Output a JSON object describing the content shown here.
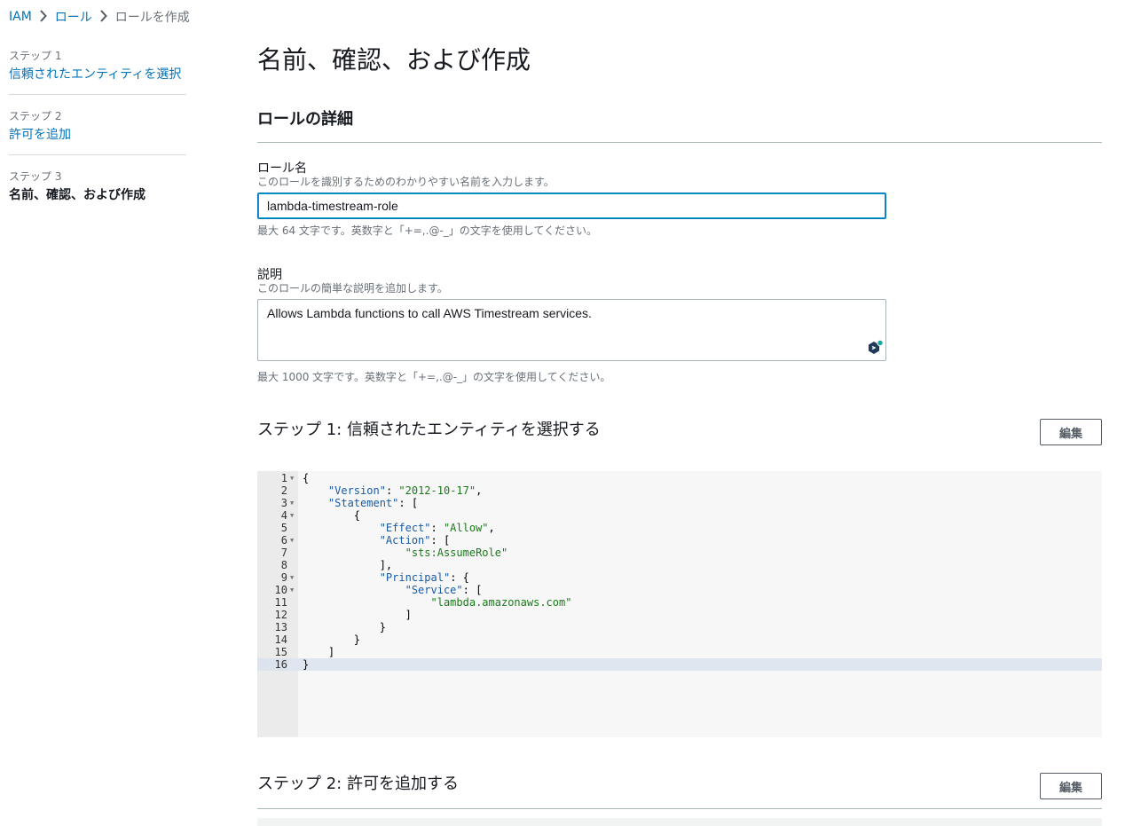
{
  "breadcrumb": {
    "items": [
      "IAM",
      "ロール"
    ],
    "current": "ロールを作成"
  },
  "sidebar": {
    "steps": [
      {
        "number": "ステップ 1",
        "label": "信頼されたエンティティを選択"
      },
      {
        "number": "ステップ 2",
        "label": "許可を追加"
      },
      {
        "number": "ステップ 3",
        "label": "名前、確認、および作成"
      }
    ]
  },
  "main": {
    "title": "名前、確認、および作成",
    "details_title": "ロールの詳細",
    "role_name": {
      "label": "ロール名",
      "description": "このロールを識別するためのわかりやすい名前を入力します。",
      "value": "lambda-timestream-role",
      "hint": "最大 64 文字です。英数字と「+=,.@-_」の文字を使用してください。"
    },
    "description": {
      "label": "説明",
      "description": "このロールの簡単な説明を追加します。",
      "value": "Allows Lambda functions to call AWS Timestream services.",
      "hint": "最大 1000 文字です。英数字と「+=,.@-_」の文字を使用してください。"
    },
    "step1": {
      "title": "ステップ 1: 信頼されたエンティティを選択する",
      "edit_label": "編集"
    },
    "step2": {
      "title": "ステップ 2: 許可を追加する",
      "edit_label": "編集"
    }
  },
  "policy_editor": {
    "lines": [
      {
        "n": "1",
        "fold": true,
        "indent": "",
        "parts": [
          [
            "p",
            "{"
          ]
        ]
      },
      {
        "n": "2",
        "fold": false,
        "indent": "    ",
        "parts": [
          [
            "k",
            "\"Version\""
          ],
          [
            "p",
            ": "
          ],
          [
            "s",
            "\"2012-10-17\""
          ],
          [
            "p",
            ","
          ]
        ]
      },
      {
        "n": "3",
        "fold": true,
        "indent": "    ",
        "parts": [
          [
            "k",
            "\"Statement\""
          ],
          [
            "p",
            ": ["
          ]
        ]
      },
      {
        "n": "4",
        "fold": true,
        "indent": "        ",
        "parts": [
          [
            "p",
            "{"
          ]
        ]
      },
      {
        "n": "5",
        "fold": false,
        "indent": "            ",
        "parts": [
          [
            "k",
            "\"Effect\""
          ],
          [
            "p",
            ": "
          ],
          [
            "s",
            "\"Allow\""
          ],
          [
            "p",
            ","
          ]
        ]
      },
      {
        "n": "6",
        "fold": true,
        "indent": "            ",
        "parts": [
          [
            "k",
            "\"Action\""
          ],
          [
            "p",
            ": ["
          ]
        ]
      },
      {
        "n": "7",
        "fold": false,
        "indent": "                ",
        "parts": [
          [
            "s",
            "\"sts:AssumeRole\""
          ]
        ]
      },
      {
        "n": "8",
        "fold": false,
        "indent": "            ",
        "parts": [
          [
            "p",
            "],"
          ]
        ]
      },
      {
        "n": "9",
        "fold": true,
        "indent": "            ",
        "parts": [
          [
            "k",
            "\"Principal\""
          ],
          [
            "p",
            ": {"
          ]
        ]
      },
      {
        "n": "10",
        "fold": true,
        "indent": "                ",
        "parts": [
          [
            "k",
            "\"Service\""
          ],
          [
            "p",
            ": ["
          ]
        ]
      },
      {
        "n": "11",
        "fold": false,
        "indent": "                    ",
        "parts": [
          [
            "s",
            "\"lambda.amazonaws.com\""
          ]
        ]
      },
      {
        "n": "12",
        "fold": false,
        "indent": "                ",
        "parts": [
          [
            "p",
            "]"
          ]
        ]
      },
      {
        "n": "13",
        "fold": false,
        "indent": "            ",
        "parts": [
          [
            "p",
            "}"
          ]
        ]
      },
      {
        "n": "14",
        "fold": false,
        "indent": "        ",
        "parts": [
          [
            "p",
            "}"
          ]
        ]
      },
      {
        "n": "15",
        "fold": false,
        "indent": "    ",
        "parts": [
          [
            "p",
            "]"
          ]
        ]
      },
      {
        "n": "16",
        "fold": false,
        "indent": "",
        "parts": [
          [
            "p",
            "}"
          ]
        ],
        "active": true
      }
    ]
  },
  "icons": {
    "breadcrumb_separator": "chevron-right-icon",
    "fold_marker": "fold-arrow-icon",
    "textarea_assistant": "grammarly-icon"
  },
  "colors": {
    "link": "#0073bb",
    "focus_border": "#0073bb",
    "json_key": "#1a5aa6",
    "json_string": "#1a7a1a",
    "active_line": "#dfe6f0"
  }
}
